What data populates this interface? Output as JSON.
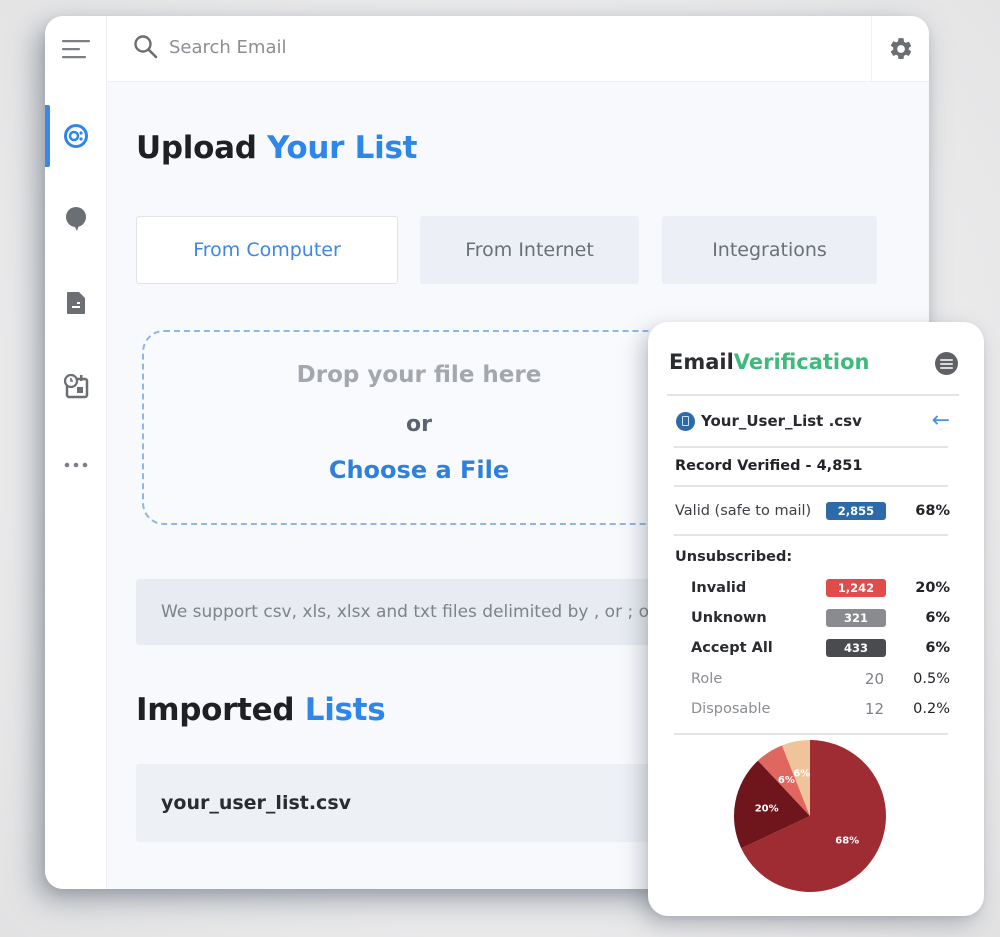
{
  "search": {
    "placeholder": "Search Email"
  },
  "sidebar": {
    "items": [
      {
        "name": "campaigns",
        "icon": "target-share-icon",
        "active": true
      },
      {
        "name": "chat",
        "icon": "chat-bubble-icon",
        "active": false
      },
      {
        "name": "documents",
        "icon": "document-icon",
        "active": false
      },
      {
        "name": "schedule",
        "icon": "clock-calendar-icon",
        "active": false
      },
      {
        "name": "more",
        "icon": "more-dots-icon",
        "active": false
      }
    ]
  },
  "upload": {
    "title_prefix": "Upload",
    "title_accent": "Your List",
    "tabs": [
      {
        "label": "From Computer",
        "active": true
      },
      {
        "label": "From Internet",
        "active": false
      },
      {
        "label": "Integrations",
        "active": false
      }
    ],
    "dropzone": {
      "drop_text": "Drop your file here",
      "or_text": "or",
      "choose_text": "Choose a File"
    },
    "support_text": "We support csv, xls, xlsx and txt files delimited by , or ; or"
  },
  "imported": {
    "title_prefix": "Imported",
    "title_accent": "Lists",
    "items": [
      "your_user_list.csv"
    ]
  },
  "verification": {
    "title_prefix": "Email",
    "title_accent": "Verification",
    "file_name": "Your_User_List .csv",
    "record_verified": "Record Verified - 4,851",
    "valid": {
      "label": "Valid (safe to mail)",
      "count": "2,855",
      "pct": "68%",
      "color": "#2d6aa9"
    },
    "unsubscribed_label": "Unsubscribed:",
    "rows": [
      {
        "label": "Invalid",
        "count": "1,242",
        "pct": "20%",
        "color": "#e24b4b",
        "badge": true
      },
      {
        "label": "Unknown",
        "count": "321",
        "pct": "6%",
        "color": "#8a8b8e",
        "badge": true
      },
      {
        "label": "Accept All",
        "count": "433",
        "pct": "6%",
        "color": "#4a4b4e",
        "badge": true
      },
      {
        "label": "Role",
        "count": "20",
        "pct": "0.5%",
        "badge": false
      },
      {
        "label": "Disposable",
        "count": "12",
        "pct": "0.2%",
        "badge": false
      }
    ]
  },
  "chart_data": {
    "type": "pie",
    "title": "",
    "slices": [
      {
        "label": "68%",
        "value": 68,
        "color": "#a02c33"
      },
      {
        "label": "20%",
        "value": 20,
        "color": "#6e161c"
      },
      {
        "label": "6%",
        "value": 6,
        "color": "#e0675f"
      },
      {
        "label": "6%",
        "value": 6,
        "color": "#f0c49a"
      }
    ],
    "start": "top",
    "direction": "clockwise"
  }
}
